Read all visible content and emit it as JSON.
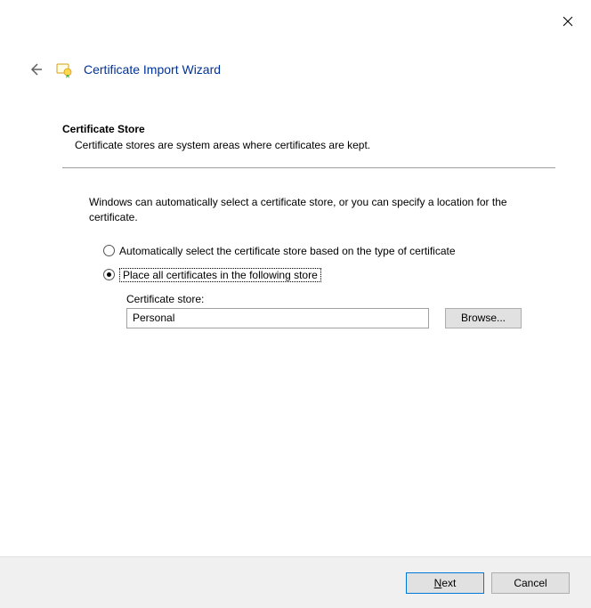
{
  "titlebar": {
    "close": "Close"
  },
  "header": {
    "title": "Certificate Import Wizard"
  },
  "section": {
    "title": "Certificate Store",
    "desc": "Certificate stores are system areas where certificates are kept."
  },
  "body": {
    "intro": "Windows can automatically select a certificate store, or you can specify a location for the certificate."
  },
  "options": {
    "auto": "Automatically select the certificate store based on the type of certificate",
    "place": "Place all certificates in the following store",
    "selected": "place"
  },
  "store": {
    "label": "Certificate store:",
    "value": "Personal",
    "browse": "Browse..."
  },
  "footer": {
    "next_prefix": "N",
    "next_suffix": "ext",
    "cancel": "Cancel"
  }
}
